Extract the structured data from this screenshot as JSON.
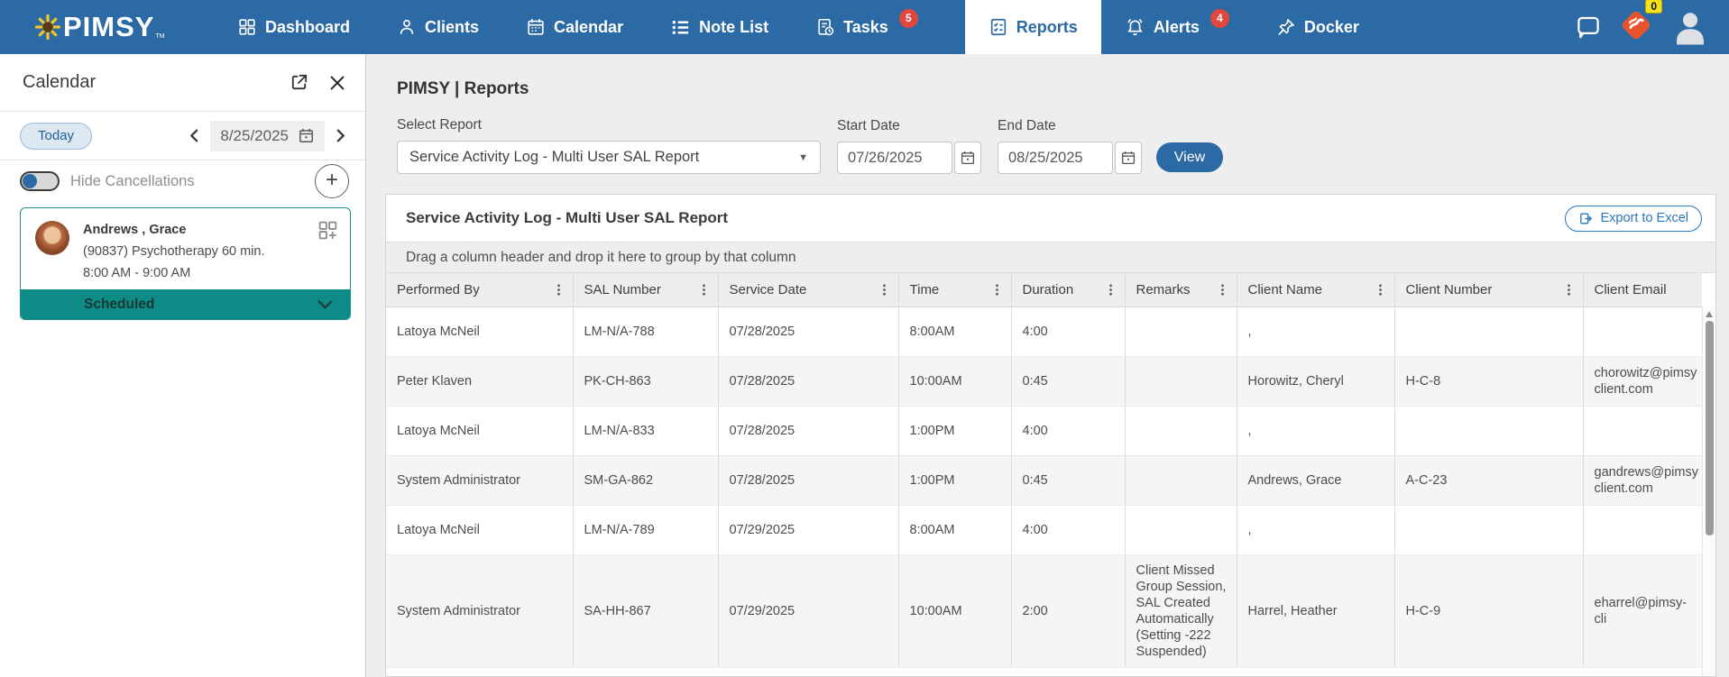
{
  "nav": {
    "logo": "PIMSY",
    "logo_tm": "TM",
    "items": [
      {
        "label": "Dashboard"
      },
      {
        "label": "Clients"
      },
      {
        "label": "Calendar"
      },
      {
        "label": "Note List"
      },
      {
        "label": "Tasks",
        "badge": "5"
      },
      {
        "label": "Reports"
      },
      {
        "label": "Alerts",
        "badge": "4"
      },
      {
        "label": "Docker"
      }
    ],
    "messages_badge": "0"
  },
  "sidebar": {
    "title": "Calendar",
    "today_label": "Today",
    "date": "8/25/2025",
    "hide_cancellations_label": "Hide Cancellations",
    "appointment": {
      "client": "Andrews , Grace",
      "service": "(90837) Psychotherapy 60 min.",
      "time": "8:00 AM - 9:00 AM",
      "status": "Scheduled"
    }
  },
  "main": {
    "breadcrumb": "PIMSY | Reports",
    "select_report_label": "Select Report",
    "select_report_value": "Service Activity Log - Multi User SAL Report",
    "start_date_label": "Start Date",
    "start_date_value": "07/26/2025",
    "end_date_label": "End Date",
    "end_date_value": "08/25/2025",
    "view_button": "View"
  },
  "report": {
    "title": "Service Activity Log - Multi User SAL Report",
    "export_button": "Export to Excel",
    "drag_hint": "Drag a column header and drop it here to group by that column",
    "table": {
      "columns": [
        {
          "key": "performed_by",
          "label": "Performed By",
          "menu": true
        },
        {
          "key": "sal_number",
          "label": "SAL Number",
          "menu": true
        },
        {
          "key": "service_date",
          "label": "Service Date",
          "menu": true
        },
        {
          "key": "time",
          "label": "Time",
          "menu": true
        },
        {
          "key": "duration",
          "label": "Duration",
          "menu": true
        },
        {
          "key": "remarks",
          "label": "Remarks",
          "menu": true
        },
        {
          "key": "client_name",
          "label": "Client Name",
          "menu": true
        },
        {
          "key": "client_number",
          "label": "Client Number",
          "menu": true
        },
        {
          "key": "client_email",
          "label": "Client Email",
          "menu": false
        }
      ],
      "rows": [
        {
          "performed_by": "Latoya McNeil",
          "sal_number": "LM-N/A-788",
          "service_date": "07/28/2025",
          "time": "8:00AM",
          "duration": "4:00",
          "remarks": "",
          "client_name": ",",
          "client_number": "",
          "client_email": ""
        },
        {
          "performed_by": "Peter Klaven",
          "sal_number": "PK-CH-863",
          "service_date": "07/28/2025",
          "time": "10:00AM",
          "duration": "0:45",
          "remarks": "",
          "client_name": "Horowitz, Cheryl",
          "client_number": "H-C-8",
          "client_email": "chorowitz@pimsy\nclient.com"
        },
        {
          "performed_by": "Latoya McNeil",
          "sal_number": "LM-N/A-833",
          "service_date": "07/28/2025",
          "time": "1:00PM",
          "duration": "4:00",
          "remarks": "",
          "client_name": ",",
          "client_number": "",
          "client_email": ""
        },
        {
          "performed_by": "System Administrator",
          "sal_number": "SM-GA-862",
          "service_date": "07/28/2025",
          "time": "1:00PM",
          "duration": "0:45",
          "remarks": "",
          "client_name": "Andrews, Grace",
          "client_number": "A-C-23",
          "client_email": "gandrews@pimsy\nclient.com"
        },
        {
          "performed_by": "Latoya McNeil",
          "sal_number": "LM-N/A-789",
          "service_date": "07/29/2025",
          "time": "8:00AM",
          "duration": "4:00",
          "remarks": "",
          "client_name": ",",
          "client_number": "",
          "client_email": ""
        },
        {
          "performed_by": "System Administrator",
          "sal_number": "SA-HH-867",
          "service_date": "07/29/2025",
          "time": "10:00AM",
          "duration": "2:00",
          "remarks": "Client Missed Group Session, SAL Created Automatically (Setting -222 Suspended)",
          "client_name": "Harrel, Heather",
          "client_number": "H-C-9",
          "client_email": "eharrel@pimsy-cli"
        }
      ]
    }
  },
  "colors": {
    "nav_blue": "#2b6aa4",
    "badge_red": "#e0483e",
    "badge_yellow": "#f7e017",
    "status_teal": "#0d8c87",
    "accent_blue": "#2b77b8"
  }
}
